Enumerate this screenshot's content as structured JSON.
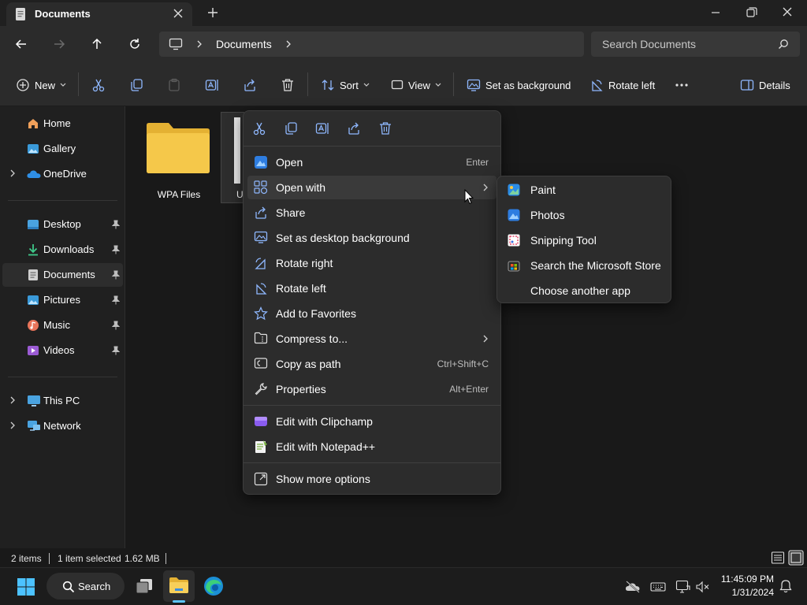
{
  "window": {
    "tab_title": "Documents",
    "new_tab_symbol": "+"
  },
  "address": {
    "location": "Documents",
    "search_placeholder": "Search Documents"
  },
  "toolbar": {
    "new_label": "New",
    "sort_label": "Sort",
    "view_label": "View",
    "set_background_label": "Set as background",
    "rotate_left_label": "Rotate left",
    "details_label": "Details"
  },
  "sidebar": {
    "items": [
      {
        "label": "Home",
        "icon": "home-icon"
      },
      {
        "label": "Gallery",
        "icon": "gallery-icon"
      },
      {
        "label": "OneDrive",
        "icon": "onedrive-icon"
      },
      {
        "label": "Desktop",
        "icon": "desktop-icon",
        "pinned": true
      },
      {
        "label": "Downloads",
        "icon": "downloads-icon",
        "pinned": true
      },
      {
        "label": "Documents",
        "icon": "documents-icon",
        "pinned": true,
        "selected": true
      },
      {
        "label": "Pictures",
        "icon": "pictures-icon",
        "pinned": true
      },
      {
        "label": "Music",
        "icon": "music-icon",
        "pinned": true
      },
      {
        "label": "Videos",
        "icon": "videos-icon",
        "pinned": true
      },
      {
        "label": "This PC",
        "icon": "this-pc-icon"
      },
      {
        "label": "Network",
        "icon": "network-icon"
      }
    ]
  },
  "content": {
    "folder_name": "WPA Files",
    "file_name_partial": "U"
  },
  "status": {
    "item_count": "2 items",
    "selection": "1 item selected",
    "size": "1.62 MB"
  },
  "context_menu": {
    "items": [
      {
        "label": "Open",
        "shortcut": "Enter"
      },
      {
        "label": "Open with",
        "shortcut": "",
        "submenu": true,
        "hover": true
      },
      {
        "label": "Share",
        "shortcut": ""
      },
      {
        "label": "Set as desktop background",
        "shortcut": ""
      },
      {
        "label": "Rotate right",
        "shortcut": ""
      },
      {
        "label": "Rotate left",
        "shortcut": ""
      },
      {
        "label": "Add to Favorites",
        "shortcut": ""
      },
      {
        "label": "Compress to...",
        "shortcut": "",
        "submenu": true
      },
      {
        "label": "Copy as path",
        "shortcut": "Ctrl+Shift+C"
      },
      {
        "label": "Properties",
        "shortcut": "Alt+Enter"
      },
      {
        "label": "Edit with Clipchamp",
        "shortcut": ""
      },
      {
        "label": "Edit with Notepad++",
        "shortcut": ""
      },
      {
        "label": "Show more options",
        "shortcut": ""
      }
    ]
  },
  "open_with_menu": {
    "items": [
      {
        "label": "Paint",
        "icon": "paint-icon"
      },
      {
        "label": "Photos",
        "icon": "photos-icon"
      },
      {
        "label": "Snipping Tool",
        "icon": "snipping-tool-icon"
      },
      {
        "label": "Search the Microsoft Store",
        "icon": "store-icon"
      },
      {
        "label": "Choose another app",
        "icon": ""
      }
    ]
  },
  "taskbar": {
    "search_label": "Search",
    "time": "11:45:09 PM",
    "date": "1/31/2024"
  },
  "colors": {
    "accent": "#5cc5ff",
    "folder": "#f5c84a",
    "menu_bg": "#2c2c2c"
  }
}
